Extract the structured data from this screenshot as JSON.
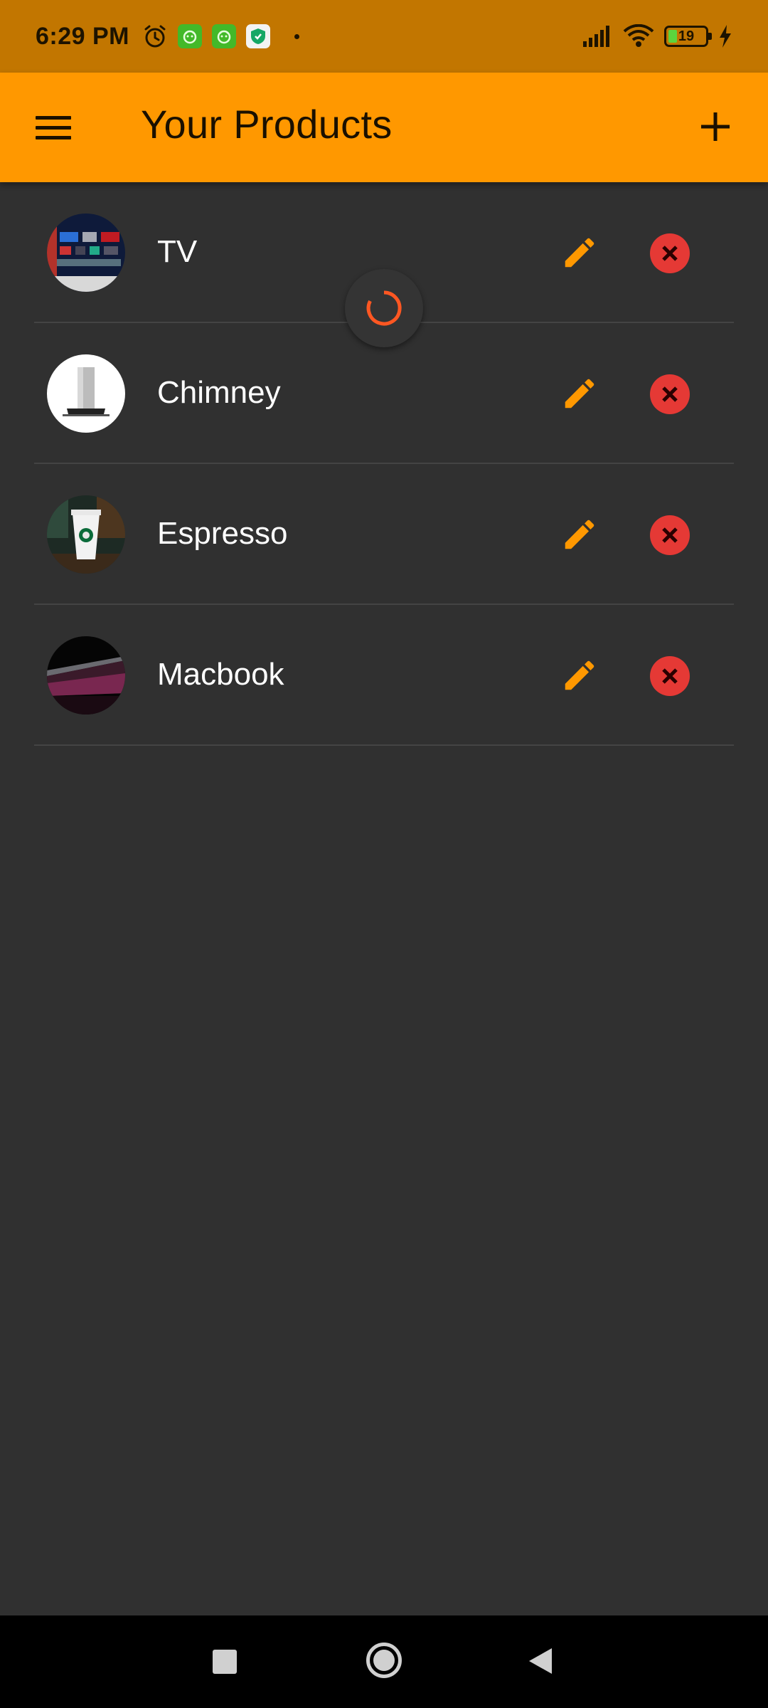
{
  "status_bar": {
    "time": "6:29 PM",
    "battery_level": "19",
    "icons": [
      "alarm-icon",
      "app-icon",
      "app-icon",
      "shield-icon",
      "signal-icon",
      "wifi-icon",
      "battery-icon",
      "charging-icon"
    ]
  },
  "app_bar": {
    "title": "Your Products",
    "menu_icon": "menu-icon",
    "add_icon": "add-icon"
  },
  "products": [
    {
      "name": "TV",
      "thumbnail": "tv-thumbnail"
    },
    {
      "name": "Chimney",
      "thumbnail": "chimney-thumbnail"
    },
    {
      "name": "Espresso",
      "thumbnail": "espresso-thumbnail"
    },
    {
      "name": "Macbook",
      "thumbnail": "macbook-thumbnail"
    }
  ],
  "colors": {
    "status_bar": "#c27600",
    "app_bar": "#ff9800",
    "background": "#303030",
    "edit_icon": "#ff9800",
    "delete_icon": "#e53935",
    "spinner": "#ff5722"
  },
  "nav_bar": {
    "icons": [
      "recents-icon",
      "home-icon",
      "back-icon"
    ]
  }
}
